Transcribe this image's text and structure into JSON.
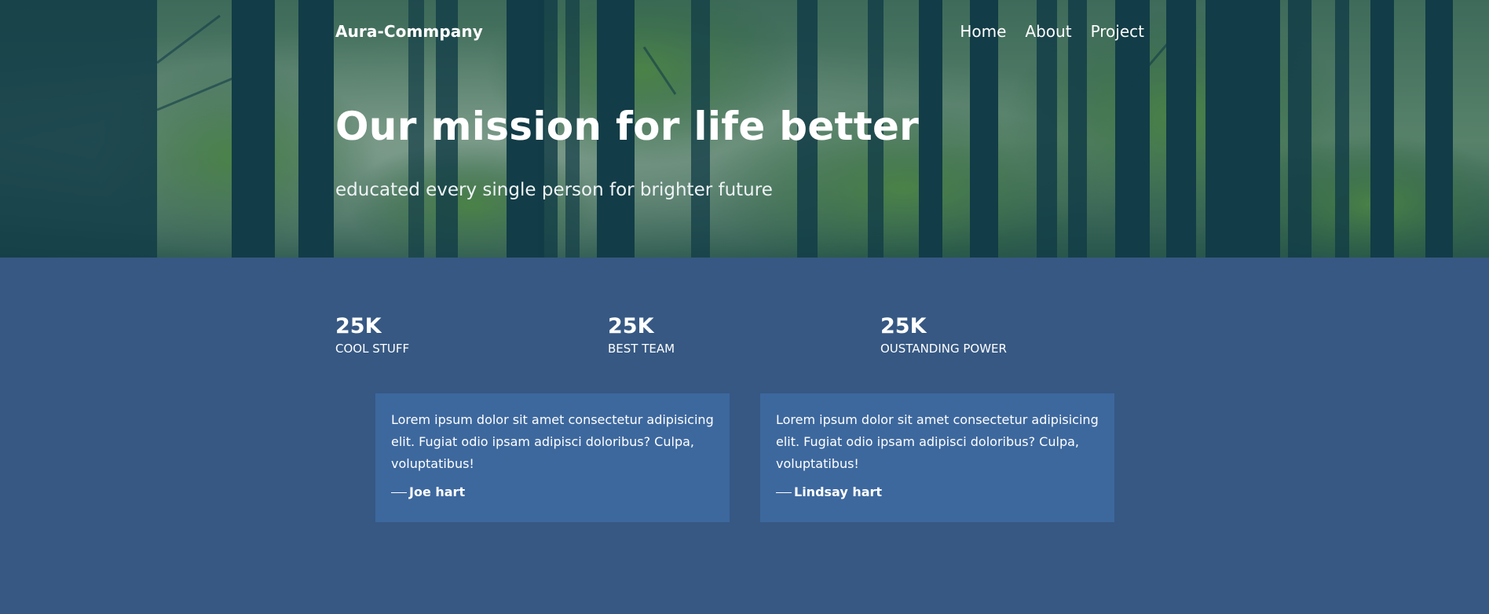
{
  "header": {
    "brand": "Aura-Commpany",
    "nav": [
      {
        "label": "Home"
      },
      {
        "label": "About"
      },
      {
        "label": "Project"
      }
    ]
  },
  "hero": {
    "title": "Our mission for life better",
    "subtitle": "educated every single person for brighter future"
  },
  "stats": [
    {
      "value": "25K",
      "label": "COOL STUFF"
    },
    {
      "value": "25K",
      "label": "BEST TEAM"
    },
    {
      "value": "25K",
      "label": "OUSTANDING POWER"
    }
  ],
  "testimonials": [
    {
      "quote": "Lorem ipsum dolor sit amet consectetur adipisicing elit. Fugiat odio ipsam adipisci doloribus? Culpa, voluptatibus!",
      "author": "Joe hart"
    },
    {
      "quote": "Lorem ipsum dolor sit amet consectetur adipisicing elit. Fugiat odio ipsam adipisci doloribus? Culpa, voluptatibus!",
      "author": "Lindsay hart"
    }
  ],
  "colors": {
    "page_background": "#365883",
    "card_background": "#3d689e",
    "text": "#ffffff"
  }
}
